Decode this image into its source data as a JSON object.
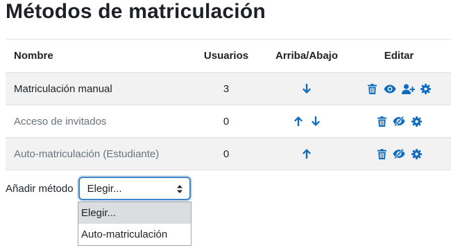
{
  "page": {
    "title": "Métodos de matriculación"
  },
  "table": {
    "headers": {
      "name": "Nombre",
      "users": "Usuarios",
      "updown": "Arriba/Abajo",
      "edit": "Editar"
    },
    "rows": [
      {
        "name": "Matriculación manual",
        "users": "3",
        "enabled": true
      },
      {
        "name": "Acceso de invitados",
        "users": "0",
        "enabled": false
      },
      {
        "name": "Auto-matriculación (Estudiante)",
        "users": "0",
        "enabled": false
      }
    ]
  },
  "add_method": {
    "label": "Añadir método",
    "selected": "Elegir...",
    "options": [
      "Elegir...",
      "Auto-matriculación"
    ]
  },
  "colors": {
    "icon": "#0f6cbf",
    "focus": "#3c84c6"
  },
  "icons": {
    "up": "arrow-up-icon",
    "down": "arrow-down-icon",
    "delete": "trash-icon",
    "hide": "eye-icon",
    "show": "eye-slash-icon",
    "enrol": "user-plus-icon",
    "settings": "cog-icon"
  }
}
